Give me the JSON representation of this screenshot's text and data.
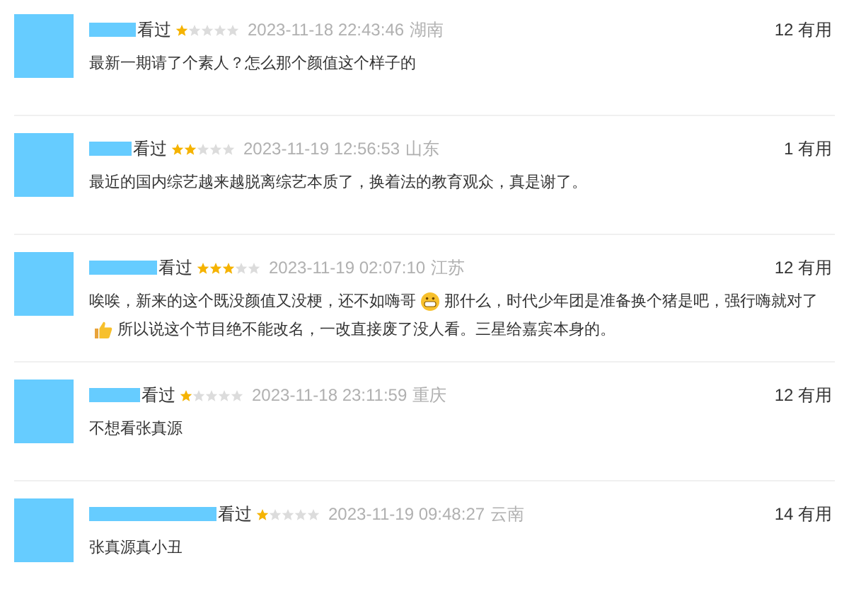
{
  "comments": [
    {
      "watched": "看过",
      "stars": 1,
      "time": "2023-11-18 22:43:46",
      "location": "湖南",
      "useful": "12 有用",
      "body": [
        {
          "kind": "text",
          "text": "最新一期请了个素人？怎么那个颜值这个样子的"
        }
      ]
    },
    {
      "watched": "看过",
      "stars": 2,
      "time": "2023-11-19 12:56:53",
      "location": "山东",
      "useful": "1 有用",
      "body": [
        {
          "kind": "text",
          "text": "最近的国内综艺越来越脱离综艺本质了，换着法的教育观众，真是谢了。"
        }
      ]
    },
    {
      "watched": "看过",
      "stars": 3,
      "time": "2023-11-19 02:07:10",
      "location": "江苏",
      "useful": "12 有用",
      "body": [
        {
          "kind": "text",
          "text": "唉唉，新来的这个既没颜值又没梗，还不如嗨哥"
        },
        {
          "kind": "grin"
        },
        {
          "kind": "text",
          "text": "那什么，时代少年团是准备换个猪是吧，强行嗨就对了"
        },
        {
          "kind": "thumb"
        },
        {
          "kind": "text",
          "text": "所以说这个节目绝不能改名，一改直接废了没人看。三星给嘉宾本身的。"
        }
      ]
    },
    {
      "watched": "看过",
      "stars": 1,
      "time": "2023-11-18 23:11:59",
      "location": "重庆",
      "useful": "12 有用",
      "body": [
        {
          "kind": "text",
          "text": "不想看张真源"
        }
      ]
    },
    {
      "watched": "看过",
      "stars": 1,
      "time": "2023-11-19 09:48:27",
      "location": "云南",
      "useful": "14 有用",
      "body": [
        {
          "kind": "text",
          "text": "张真源真小丑"
        }
      ]
    }
  ]
}
